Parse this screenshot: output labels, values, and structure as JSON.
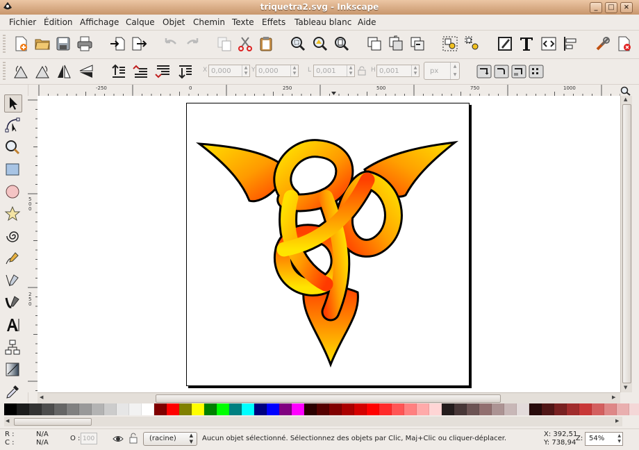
{
  "window": {
    "title": "triquetra2.svg - Inkscape",
    "buttons": [
      "_",
      "□",
      "×"
    ]
  },
  "menubar": {
    "items": [
      "Fichier",
      "Édition",
      "Affichage",
      "Calque",
      "Objet",
      "Chemin",
      "Texte",
      "Effets",
      "Tableau blanc",
      "Aide"
    ]
  },
  "toolbar2": {
    "x_label": "X",
    "x_value": "0,000",
    "y_label": "Y",
    "y_value": "0,000",
    "w_label": "L",
    "w_value": "0,001",
    "h_label": "H",
    "h_value": "0,001",
    "unit": "px"
  },
  "ruler": {
    "h_labels": [
      "-250",
      "0",
      "250",
      "500",
      "750",
      "1000"
    ],
    "v_labels": [
      "5 0 0",
      "2 5 0"
    ]
  },
  "palette": {
    "colors": [
      "#000000",
      "#1c1c1c",
      "#333333",
      "#4d4d4d",
      "#666666",
      "#808080",
      "#999999",
      "#b3b3b3",
      "#cccccc",
      "#e6e6e6",
      "#f2f2f2",
      "#ffffff",
      "#800000",
      "#ff0000",
      "#808000",
      "#ffff00",
      "#008000",
      "#00ff00",
      "#008080",
      "#00ffff",
      "#000080",
      "#0000ff",
      "#800080",
      "#ff00ff",
      "#2b0000",
      "#550000",
      "#800000",
      "#aa0000",
      "#d40000",
      "#ff0000",
      "#ff2a2a",
      "#ff5555",
      "#ff8080",
      "#ffaaaa",
      "#ffd5d5",
      "#241c1c",
      "#483737",
      "#6c5353",
      "#916f6f",
      "#ac9393",
      "#c8b7b7",
      "#e3dbdb",
      "#280b0b",
      "#501616",
      "#782121",
      "#a02c2c",
      "#c83737",
      "#d35f5f",
      "#de8787",
      "#e9afaf",
      "#f4d7d7",
      "#2b2b2b",
      "#4d4d4d",
      "#666666",
      "#8a8a8a",
      "#aaaaaa",
      "#c8c8c8",
      "#e0e0e0",
      "#2b1100",
      "#552200",
      "#803300"
    ]
  },
  "status": {
    "r_label": "R :",
    "c_label": "C :",
    "r_value": "N/A",
    "c_value": "N/A",
    "opacity_label": "O :",
    "opacity_value": "100",
    "layer": "(racine)",
    "message": "Aucun objet sélectionné. Sélectionnez des objets par Clic, Maj+Clic ou cliquer-déplacer.",
    "x_coord": "X: 392,51",
    "y_coord": "Y: 738,94",
    "zoom_label": "Z:",
    "zoom_value": "54%"
  }
}
